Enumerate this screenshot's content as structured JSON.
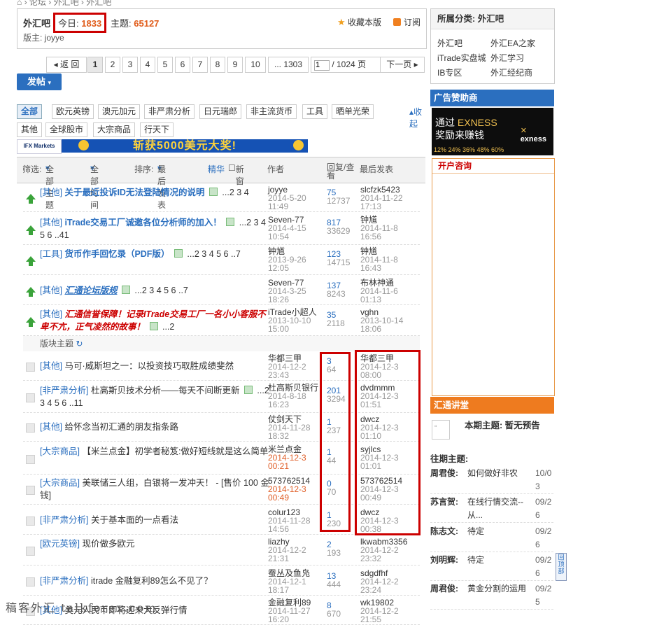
{
  "header": {
    "forum_name": "外汇吧",
    "today_label": "今日:",
    "today_count": "1833",
    "topic_label": "主题:",
    "topic_count": "65127",
    "moderator": "版主: joyye",
    "favorite": "收藏本版",
    "subscribe": "订阅"
  },
  "pager": {
    "back": "返 回",
    "pages": [
      "1",
      "2",
      "3",
      "4",
      "5",
      "6",
      "7",
      "8",
      "9",
      "10"
    ],
    "last": "... 1303",
    "page_input": "1",
    "total": "/ 1024 页",
    "next": "下一页"
  },
  "post_button": "发帖",
  "categories": [
    "全部",
    "欧元英镑",
    "澳元加元",
    "非严肃分析",
    "日元瑞郎",
    "非主流货币",
    "工具",
    "晒单光荣",
    "其他",
    "全球股市",
    "大宗商品",
    "行天下"
  ],
  "collapse": "收起",
  "banner": {
    "ifx": "IFX Markets",
    "promo": "斩获5000美元大奖!"
  },
  "table_header": {
    "filter": "筛选:",
    "all_topics": "全部主题",
    "all_time": "全部时间",
    "sort": "排序:",
    "last_post": "最后发表",
    "digest": "精华",
    "new_window": "新窗",
    "author": "作者",
    "replies_views": "回复/查看",
    "last_col": "最后发表"
  },
  "section_label": "版块主题",
  "threads": [
    {
      "icon": "up",
      "tag": "[其他]",
      "title": "关于最近投诉ID无法登陆情况的说明",
      "style": "bl",
      "pages": "...2 3 4",
      "author": "joyye",
      "date": "2014-5-20 11:49",
      "replies": "75",
      "views": "12737",
      "last_user": "slcfzk5423",
      "last_date": "2014-11-22 17:13"
    },
    {
      "icon": "up",
      "tag": "[其他]",
      "title": "iTrade交易工厂诚邀各位分析师的加入！",
      "style": "bl",
      "pages": "...2 3 4 5 6 ..41",
      "author": "Seven-77",
      "date": "2014-4-15 10:54",
      "replies": "817",
      "views": "33629",
      "last_user": "钟馗",
      "last_date": "2014-11-8 16:56"
    },
    {
      "icon": "up",
      "tag": "[工具]",
      "title": "货币作手回忆录（PDF版）",
      "style": "bl",
      "pages": "...2 3 4 5 6 ..7",
      "author": "钟馗",
      "date": "2013-9-26 12:05",
      "replies": "123",
      "views": "14715",
      "last_user": "钟馗",
      "last_date": "2014-11-8 16:43"
    },
    {
      "icon": "up",
      "tag": "[其他]",
      "title": "汇通论坛版规",
      "style": "und",
      "pages": "...2 3 4 5 6 ..7",
      "author": "Seven-77",
      "date": "2014-3-25 18:26",
      "replies": "137",
      "views": "8243",
      "last_user": "布林神通",
      "last_date": "2014-11-6 01:13"
    },
    {
      "icon": "up",
      "tag": "[其他]",
      "title": "汇通信誉保障！记录ITrade交易工厂一名小小客服不卑不亢，正气凌然的故事！",
      "style": "red",
      "pages": "...2",
      "author": "iTrade小超人",
      "date": "2013-10-10 15:00",
      "replies": "35",
      "views": "2118",
      "last_user": "vghn",
      "last_date": "2013-10-14 18:06"
    },
    {
      "icon": "doc",
      "tag": "[其他]",
      "title": "马可·威斯坦之一：以投资技巧取胜成绩斐然",
      "style": "",
      "pages": "",
      "author": "华都三甲",
      "date": "2014-12-2 23:43",
      "replies": "3",
      "views": "64",
      "last_user": "华都三甲",
      "last_date": "2014-12-3 08:00"
    },
    {
      "icon": "doc",
      "tag": "[非严肃分析]",
      "title": "杜高斯贝技术分析——每天不间断更新",
      "style": "",
      "pages": "...2 3 4 5 6 ..11",
      "author": "杜高斯贝银行",
      "date": "2014-8-18 16:23",
      "replies": "201",
      "views": "3294",
      "last_user": "dvdmmm",
      "last_date": "2014-12-3 01:51"
    },
    {
      "icon": "doc",
      "tag": "[其他]",
      "title": "给怀念当初汇通的朋友指条路",
      "style": "",
      "pages": "",
      "author": "仗剑天下",
      "date": "2014-11-28 18:32",
      "replies": "1",
      "views": "237",
      "last_user": "dwcz",
      "last_date": "2014-12-3 01:10"
    },
    {
      "icon": "doc",
      "tag": "[大宗商品]",
      "title": "【米兰点金】初学者秘笈:做好短线就是这么简单",
      "style": "",
      "pages": "",
      "author": "米兰点金",
      "date": "2014-12-3 00:21",
      "datered": true,
      "replies": "1",
      "views": "44",
      "last_user": "syjlcs",
      "last_date": "2014-12-3 01:01"
    },
    {
      "icon": "doc",
      "tag": "[大宗商品]",
      "title": "美联储三人组，白银将一发冲天！ - [售价 100 金钱]",
      "style": "",
      "pages": "",
      "author": "573762514",
      "date": "2014-12-3 00:49",
      "datered": true,
      "replies": "0",
      "views": "70",
      "last_user": "573762514",
      "last_date": "2014-12-3 00:49"
    },
    {
      "icon": "doc",
      "tag": "[非严肃分析]",
      "title": "关于基本面的一点看法",
      "style": "",
      "pages": "",
      "author": "colur123",
      "date": "2014-11-28 14:56",
      "replies": "1",
      "views": "230",
      "last_user": "dwcz",
      "last_date": "2014-12-3 00:38"
    },
    {
      "icon": "doc",
      "tag": "[欧元英镑]",
      "title": "现价做多欧元",
      "style": "",
      "pages": "",
      "author": "liazhy",
      "date": "2014-12-2 21:31",
      "replies": "2",
      "views": "193",
      "last_user": "lkwabm3356",
      "last_date": "2014-12-2 23:32"
    },
    {
      "icon": "doc",
      "tag": "[非严肃分析]",
      "title": "itrade 金融复利89怎么不见了？",
      "style": "",
      "pages": "",
      "author": "蚕丛及鱼凫",
      "date": "2014-12-1 18:17",
      "replies": "13",
      "views": "444",
      "last_user": "sdgdfhf",
      "last_date": "2014-12-2 23:24"
    },
    {
      "icon": "doc",
      "tag": "[其他]",
      "title": "美元人民币即将迎来大反弹行情",
      "style": "",
      "pages": "",
      "author": "金融复利89",
      "date": "2014-11-27 16:20",
      "replies": "8",
      "views": "670",
      "last_user": "wk19802",
      "last_date": "2014-12-2 21:55"
    }
  ],
  "sidebar": {
    "category_title": "所属分类: 外汇吧",
    "links": [
      "外汇吧",
      "外汇EA之家",
      "iTrade实盘城",
      "外汇学习",
      "IB专区",
      "外汇经纪商"
    ],
    "sponsor_title": "广告赞助商",
    "exness_line1": "通过",
    "exness_brand": "EXNESS",
    "exness_line2": "奖励来赚钱",
    "exness_logo": "exness",
    "exness_pcts": "12% 24% 36% 48% 60%",
    "consult_title": "开户咨询",
    "lecture_title": "汇通讲堂",
    "current_label": "本期主题:",
    "current_value": "暂无预告",
    "past_label": "往期主题:",
    "past": [
      {
        "name": "周君俊:",
        "topic": "如何做好非农",
        "date": "10/03"
      },
      {
        "name": "苏言贺:",
        "topic": "在线行情交流--从...",
        "date": "09/26"
      },
      {
        "name": "陈志文:",
        "topic": "待定",
        "date": "09/26"
      },
      {
        "name": "刘明辉:",
        "topic": "待定",
        "date": "09/26"
      },
      {
        "name": "周君俊:",
        "topic": "黄金分割的运用",
        "date": "09/25"
      }
    ],
    "scroll_top": "回顶部"
  },
  "watermark": "稿客外汇 talkforex.com"
}
